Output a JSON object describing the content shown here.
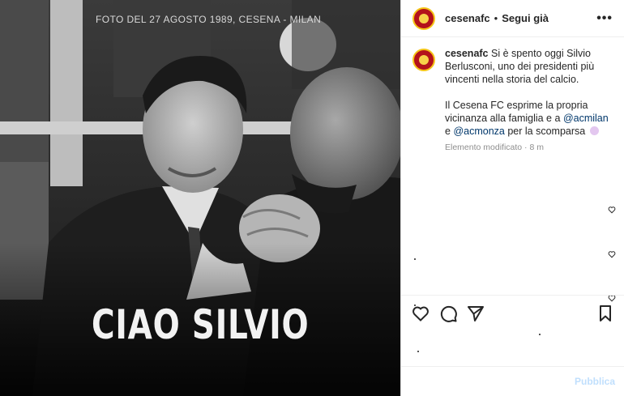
{
  "photo": {
    "caption": "FOTO DEL 27 AGOSTO 1989, CESENA - MILAN",
    "headline": "CIAO SILVIO"
  },
  "header": {
    "username": "cesenafc",
    "separator": "•",
    "follow_label": "Segui già",
    "more_icon": "more-options-icon"
  },
  "post": {
    "username": "cesenafc",
    "text_1": "Si è spento oggi Silvio Berlusconi, uno dei presidenti più vincenti nella storia del calcio.",
    "text_2_before": "Il Cesena FC esprime la propria vicinanza alla famiglia e a",
    "mention_1": "@acmilan",
    "text_2_mid": "e",
    "mention_2": "@acmonza",
    "text_2_after": "per la scomparsa",
    "meta": "Elemento modificato · 8 m"
  },
  "actions": {
    "like_icon": "heart-icon",
    "comment_icon": "comment-icon",
    "share_icon": "share-icon",
    "save_icon": "bookmark-icon"
  },
  "composer": {
    "placeholder": "",
    "publish_label": "Pubblica"
  },
  "colors": {
    "brand_red": "#b3121b",
    "brand_yellow": "#f5c518",
    "mention_blue": "#00376b",
    "publish_disabled": "#c0dffd"
  }
}
